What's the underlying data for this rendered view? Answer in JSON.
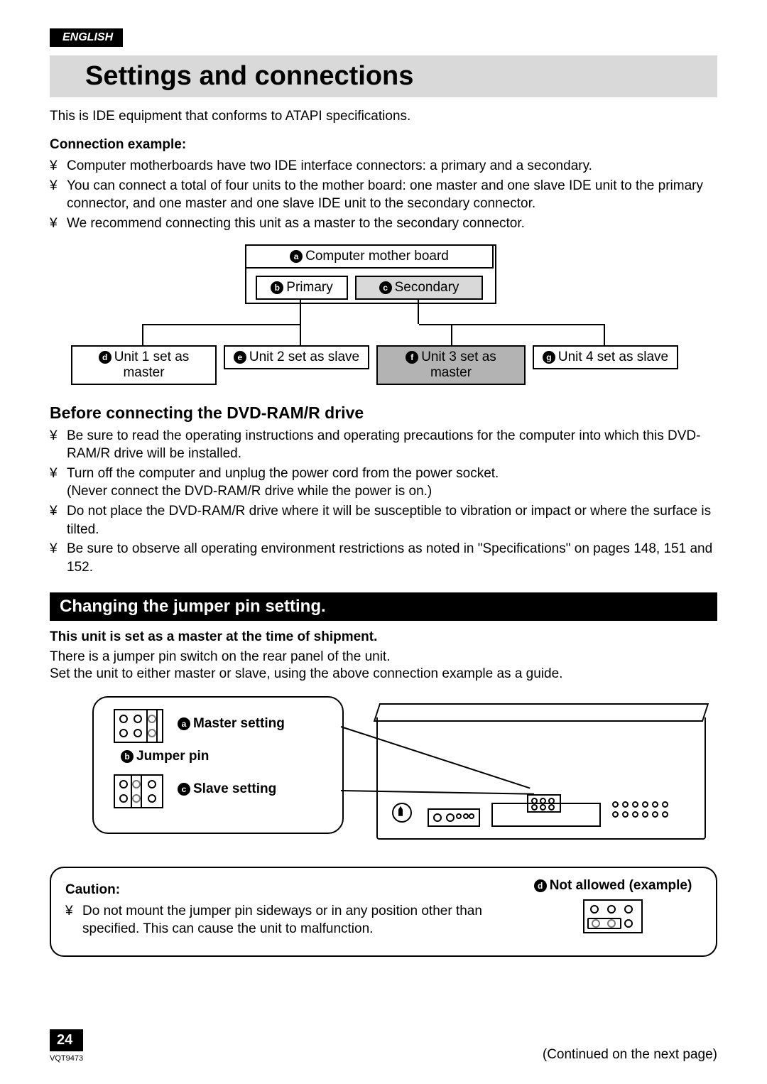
{
  "language_badge": "ENGLISH",
  "title": "Settings and connections",
  "intro": "This is IDE equipment that conforms to ATAPI specifications.",
  "connection_example_heading": "Connection example:",
  "connection_bullets": [
    "Computer motherboards have two IDE interface connectors: a primary and a secondary.",
    "You can connect a total of four units to the mother board: one master and one slave IDE unit to the primary connector, and one master and one slave IDE unit to the secondary connector.",
    "We recommend connecting this unit as a master to the secondary connector."
  ],
  "diagram": {
    "motherboard": {
      "badge": "a",
      "label": "Computer mother board"
    },
    "primary": {
      "badge": "b",
      "label": "Primary"
    },
    "secondary": {
      "badge": "c",
      "label": "Secondary"
    },
    "units": [
      {
        "badge": "d",
        "label": "Unit 1 set as master"
      },
      {
        "badge": "e",
        "label": "Unit 2 set as slave"
      },
      {
        "badge": "f",
        "label": "Unit 3 set as master"
      },
      {
        "badge": "g",
        "label": "Unit 4 set as slave"
      }
    ]
  },
  "before_heading": "Before connecting the DVD-RAM/R drive",
  "before_bullets": [
    "Be sure to read the operating instructions and operating precautions for the computer into which this DVD-RAM/R drive will be installed.",
    "Turn off the computer and unplug the power cord from the power socket.",
    "Do not place the DVD-RAM/R drive where it will be susceptible to vibration or impact or where the surface is tilted.",
    "Be sure to observe all operating environment restrictions as noted in \"Specifications\" on pages 148, 151 and 152."
  ],
  "before_sub_note": "(Never connect the DVD-RAM/R drive while the power is on.)",
  "section_band": "Changing the jumper pin setting.",
  "jumper": {
    "bold_line": "This unit is set as a master at the time of shipment.",
    "line2": "There is a jumper pin switch on the rear panel of the unit.",
    "line3": "Set the unit to either master or slave, using the above connection example as a guide.",
    "master": {
      "badge": "a",
      "label": "Master setting"
    },
    "pin": {
      "badge": "b",
      "label": "Jumper pin"
    },
    "slave": {
      "badge": "c",
      "label": "Slave setting"
    }
  },
  "caution": {
    "heading": "Caution:",
    "bullet": "Do not mount the jumper pin sideways or in any position other than specified. This can cause the unit to malfunction.",
    "not_allowed": {
      "badge": "d",
      "label": "Not allowed (example)"
    }
  },
  "footer": {
    "page_number": "24",
    "doc_code": "VQT9473",
    "continued": "(Continued on the next page)"
  }
}
